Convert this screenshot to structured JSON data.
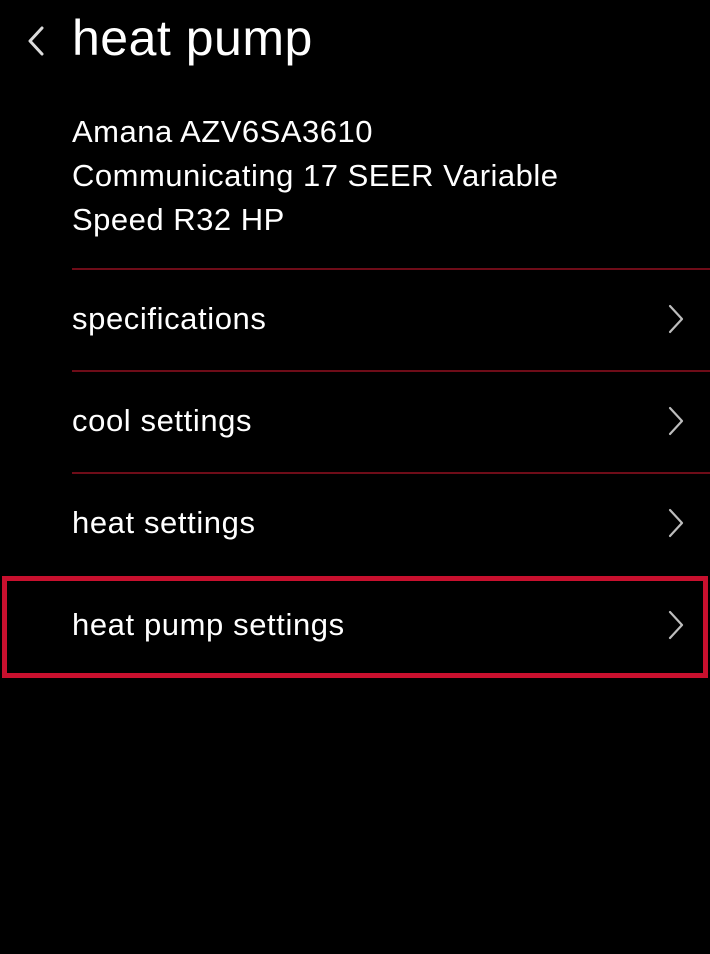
{
  "header": {
    "title": "heat pump",
    "back_icon": "chevron-left-icon"
  },
  "device": {
    "lines": [
      "Amana AZV6SA3610",
      "Communicating 17 SEER Variable",
      "Speed R32 HP"
    ]
  },
  "menu": {
    "items": [
      {
        "label": "specifications",
        "icon": "chevron-right-icon"
      },
      {
        "label": "cool settings",
        "icon": "chevron-right-icon"
      },
      {
        "label": "heat settings",
        "icon": "chevron-right-icon"
      },
      {
        "label": "heat pump settings",
        "icon": "chevron-right-icon",
        "highlighted": true
      }
    ]
  },
  "colors": {
    "background": "#000000",
    "text": "#ffffff",
    "divider": "#6e0c18",
    "highlight": "#c8102e",
    "chevron": "#bdbdbd"
  }
}
